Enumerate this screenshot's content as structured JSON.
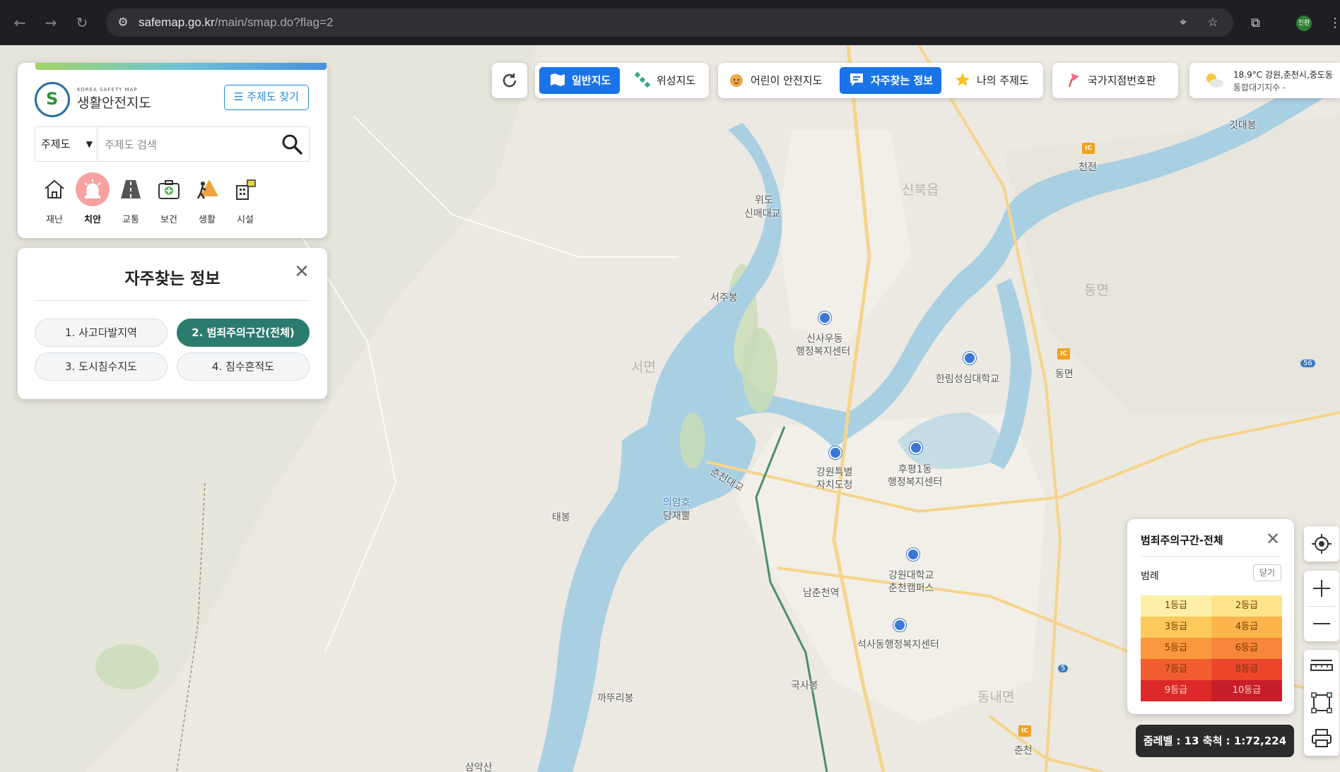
{
  "browser": {
    "url_host": "safemap.go.kr",
    "url_path": "/main/smap.do?flag=2",
    "profile_initials": "진환"
  },
  "search_panel": {
    "logo_sub": "KOREA SAFETY MAP",
    "logo_text": "생활안전지도",
    "theme_find_label": "주제도 찾기",
    "select_value": "주제도",
    "search_placeholder": "주제도 검색",
    "categories": [
      {
        "label": "재난",
        "icon": "house-disaster-icon"
      },
      {
        "label": "치안",
        "icon": "siren-icon",
        "active": true
      },
      {
        "label": "교통",
        "icon": "road-icon"
      },
      {
        "label": "보건",
        "icon": "medical-kit-icon"
      },
      {
        "label": "생활",
        "icon": "person-warning-icon"
      },
      {
        "label": "시설",
        "icon": "building-icon"
      }
    ]
  },
  "fav_panel": {
    "title": "자주찾는 정보",
    "buttons": [
      {
        "label": "1. 사고다발지역"
      },
      {
        "label": "2. 범죄주의구간(전체)",
        "active": true
      },
      {
        "label": "3. 도시침수지도"
      },
      {
        "label": "4. 침수흔적도"
      }
    ]
  },
  "toolbar": {
    "general_map": "일반지도",
    "satellite_map": "위성지도",
    "child_map": "어린이 안전지도",
    "fav_info": "자주찾는 정보",
    "my_theme": "나의 주제도",
    "national_point": "국가지점번호판",
    "weather_temp": "18.9°C",
    "weather_region": "강원,춘천시,중도동",
    "weather_air": "통합대기지수 -"
  },
  "map_labels": {
    "gitdaebong": "깃대봉",
    "cheonjeon": "천전",
    "sinbuk": "신북읍",
    "wido": "위도",
    "sinmae_bridge": "신매대교",
    "seojubong": "서주봉",
    "dongmyeon_big": "동면",
    "sinsau": "신사우동",
    "sinsau_center": "행정복지센터",
    "seomyeon": "서면",
    "hallym": "한림성심대학교",
    "dongmyeon": "동면",
    "chuncheon_bridge": "춘천대교",
    "gangwon_gov1": "강원특별",
    "gangwon_gov2": "자치도청",
    "hupyeong1": "후평1동",
    "hupyeong2": "행정복지센터",
    "taebong": "태봉",
    "uiamho": "의암호",
    "dangjaepul": "당재뿔",
    "kangwon_univ1": "강원대학교",
    "kangwon_univ2": "춘천캠퍼스",
    "namchuncheon": "남춘천역",
    "seoksa": "석사동행정복지센터",
    "guksabong": "국사봉",
    "kkattuibong": "까뚜리봉",
    "dongnae": "동내면",
    "chuncheon": "춘천",
    "samaksan": "삼악산",
    "ic_label": "IC",
    "route_56": "56",
    "route_5": "5"
  },
  "legend": {
    "title": "범죄주의구간-전체",
    "subtitle": "범례",
    "close_label": "닫기",
    "grades": [
      {
        "label": "1등급",
        "color": "#fdf0a6"
      },
      {
        "label": "2등급",
        "color": "#fde48a"
      },
      {
        "label": "3등급",
        "color": "#fcc95c"
      },
      {
        "label": "4등급",
        "color": "#fbb54c"
      },
      {
        "label": "5등급",
        "color": "#f9983e"
      },
      {
        "label": "6등급",
        "color": "#f7853a"
      },
      {
        "label": "7등급",
        "color": "#f15d2f"
      },
      {
        "label": "8등급",
        "color": "#eb452a"
      },
      {
        "label": "9등급",
        "color": "#dd2a28"
      },
      {
        "label": "10등급",
        "color": "#c81d2a"
      }
    ]
  },
  "scale": {
    "text": "줌레벨 : 13   축척 : 1:72,224"
  },
  "colors": {
    "accent": "#1a73e8",
    "fav_active": "#2a7d6e",
    "water": "#a9cfe3"
  }
}
